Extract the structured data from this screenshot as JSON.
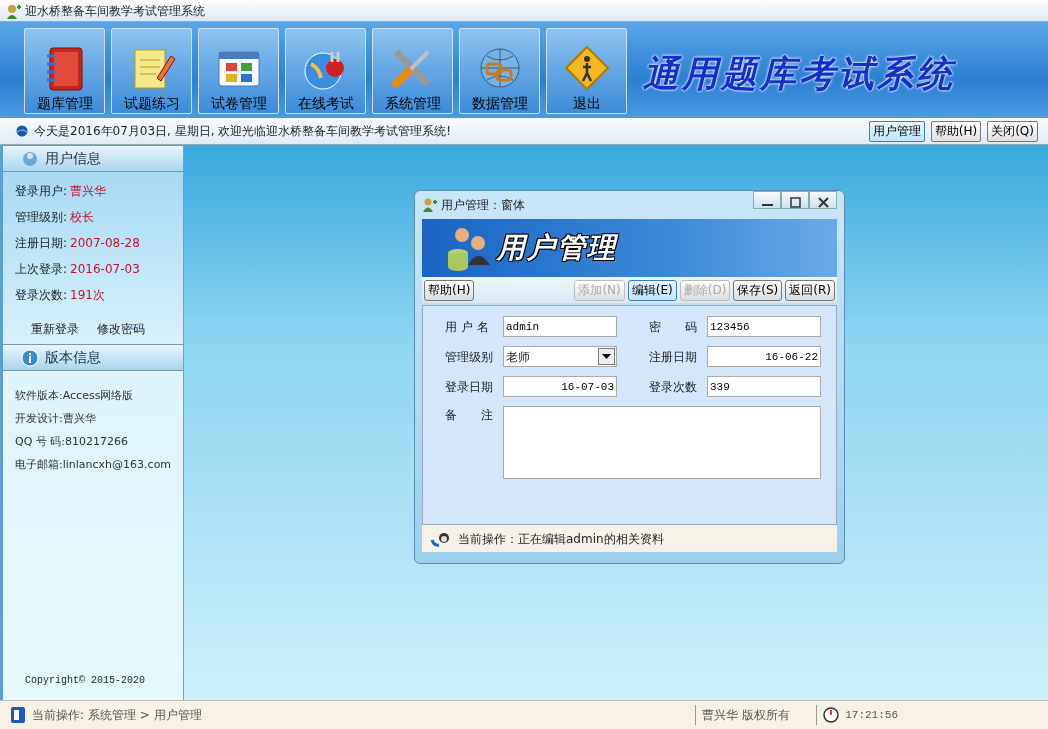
{
  "window": {
    "title": "迎水桥整备车间教学考试管理系统"
  },
  "toolbar": {
    "buttons": [
      {
        "label": "题库管理",
        "kind": "book"
      },
      {
        "label": "试题练习",
        "kind": "notepad"
      },
      {
        "label": "试卷管理",
        "kind": "grid"
      },
      {
        "label": "在线考试",
        "kind": "plug"
      },
      {
        "label": "系统管理",
        "kind": "tools"
      },
      {
        "label": "数据管理",
        "kind": "globe"
      },
      {
        "label": "退出",
        "kind": "exit"
      }
    ],
    "app_title": "通用题库考试系统"
  },
  "info_bar": {
    "message": "今天是2016年07月03日, 星期日, 欢迎光临迎水桥整备车间教学考试管理系统!",
    "buttons": [
      {
        "label": "用户管理",
        "selected": true
      },
      {
        "label": "帮助(H)",
        "selected": false
      },
      {
        "label": "关闭(Q)",
        "selected": false
      }
    ]
  },
  "sidebar": {
    "user_info": {
      "title": "用户信息",
      "fields": [
        {
          "label": "登录用户:",
          "value": "曹兴华"
        },
        {
          "label": "管理级别:",
          "value": "校长"
        },
        {
          "label": "注册日期:",
          "value": "2007-08-28"
        },
        {
          "label": "上次登录:",
          "value": "2016-07-03"
        },
        {
          "label": "登录次数:",
          "value": "191次"
        }
      ],
      "links": [
        "重新登录",
        "修改密码"
      ]
    },
    "version_info": {
      "title": "版本信息",
      "lines": [
        "软件版本:Access网络版",
        "开发设计:曹兴华",
        "QQ 号 码:810217266",
        "电子邮箱:linlancxh@163.com"
      ]
    },
    "copyright": "Copyright© 2015-2020"
  },
  "dialog": {
    "title": "用户管理：窗体",
    "banner_title": "用户管理",
    "buttons": [
      {
        "label": "帮助(H)",
        "disabled": false,
        "selected": false
      },
      {
        "label": "添加(N)",
        "disabled": true,
        "selected": false
      },
      {
        "label": "编辑(E)",
        "disabled": false,
        "selected": true
      },
      {
        "label": "删除(D)",
        "disabled": true,
        "selected": false
      },
      {
        "label": "保存(S)",
        "disabled": false,
        "selected": false
      },
      {
        "label": "返回(R)",
        "disabled": false,
        "selected": false
      }
    ],
    "fields": [
      {
        "label": "用 户 名",
        "kind": "text",
        "value": "admin"
      },
      {
        "label": "密　　码",
        "kind": "text",
        "value": "123456"
      },
      {
        "label": "管理级别",
        "kind": "select",
        "value": "老师"
      },
      {
        "label": "注册日期",
        "kind": "date",
        "value": "16-06-22"
      },
      {
        "label": "登录日期",
        "kind": "date",
        "value": "16-07-03"
      },
      {
        "label": "登录次数",
        "kind": "text",
        "value": "339"
      },
      {
        "label": "备　　注",
        "kind": "memo"
      }
    ],
    "status": "当前操作：正在编辑admin的相关资料"
  },
  "status_bar": {
    "operation": "当前操作: 系统管理 > 用户管理",
    "copyright": "曹兴华 版权所有",
    "time": "17:21:56"
  }
}
